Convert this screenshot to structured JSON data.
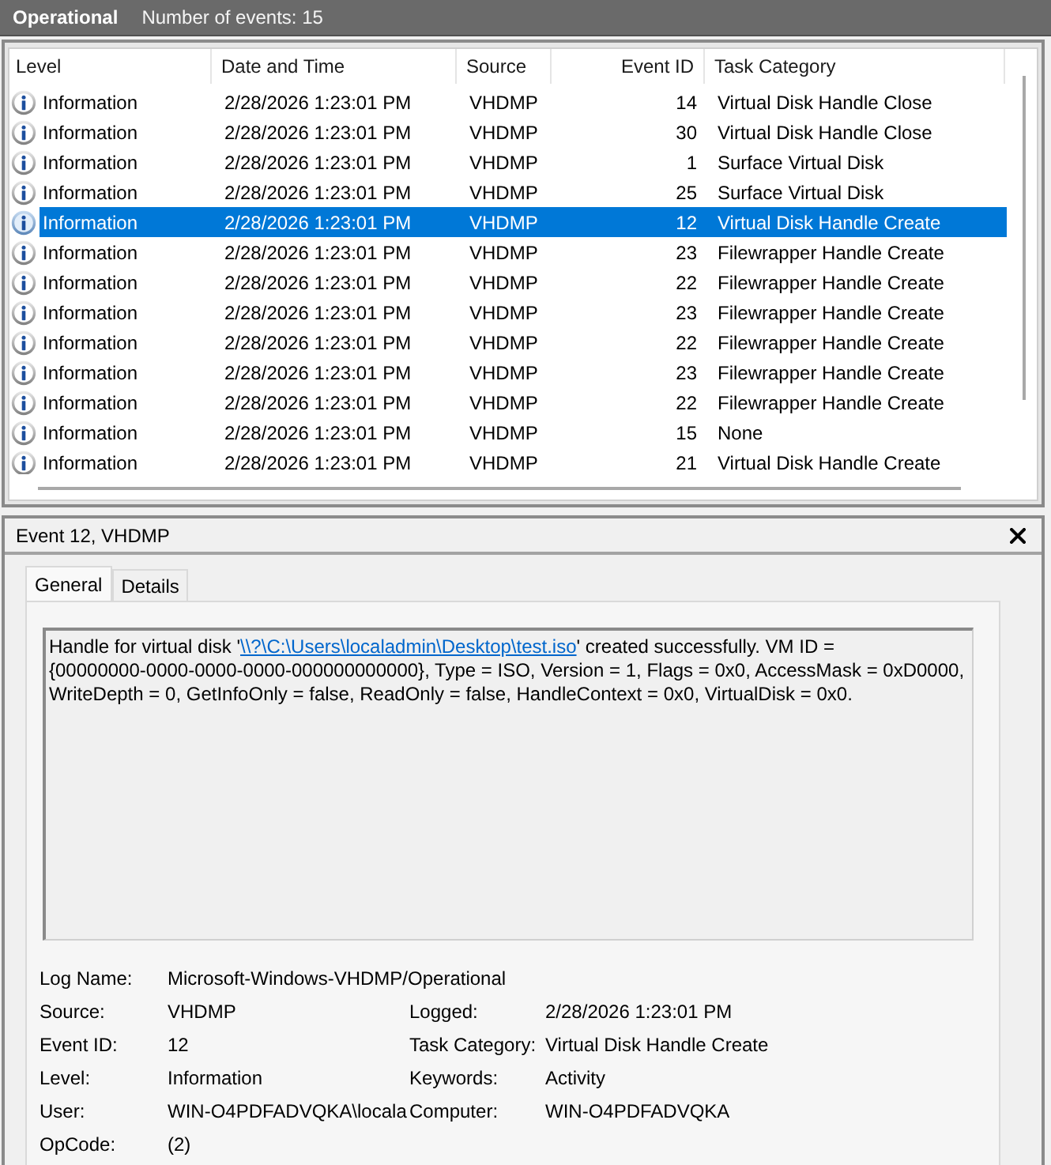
{
  "header": {
    "title": "Operational",
    "event_count": "Number of events: 15"
  },
  "event_list": {
    "columns": [
      "Level",
      "Date and Time",
      "Source",
      "Event ID",
      "Task Category"
    ],
    "rows": [
      {
        "level": "Information",
        "date_time": "2/28/2026 1:23:01 PM",
        "source": "VHDMP",
        "event_id": "14",
        "task_category": "Virtual Disk Handle Close",
        "selected": false
      },
      {
        "level": "Information",
        "date_time": "2/28/2026 1:23:01 PM",
        "source": "VHDMP",
        "event_id": "30",
        "task_category": "Virtual Disk Handle Close",
        "selected": false
      },
      {
        "level": "Information",
        "date_time": "2/28/2026 1:23:01 PM",
        "source": "VHDMP",
        "event_id": "1",
        "task_category": "Surface Virtual Disk",
        "selected": false
      },
      {
        "level": "Information",
        "date_time": "2/28/2026 1:23:01 PM",
        "source": "VHDMP",
        "event_id": "25",
        "task_category": "Surface Virtual Disk",
        "selected": false
      },
      {
        "level": "Information",
        "date_time": "2/28/2026 1:23:01 PM",
        "source": "VHDMP",
        "event_id": "12",
        "task_category": "Virtual Disk Handle Create",
        "selected": true
      },
      {
        "level": "Information",
        "date_time": "2/28/2026 1:23:01 PM",
        "source": "VHDMP",
        "event_id": "23",
        "task_category": "Filewrapper Handle Create",
        "selected": false
      },
      {
        "level": "Information",
        "date_time": "2/28/2026 1:23:01 PM",
        "source": "VHDMP",
        "event_id": "22",
        "task_category": "Filewrapper Handle Create",
        "selected": false
      },
      {
        "level": "Information",
        "date_time": "2/28/2026 1:23:01 PM",
        "source": "VHDMP",
        "event_id": "23",
        "task_category": "Filewrapper Handle Create",
        "selected": false
      },
      {
        "level": "Information",
        "date_time": "2/28/2026 1:23:01 PM",
        "source": "VHDMP",
        "event_id": "22",
        "task_category": "Filewrapper Handle Create",
        "selected": false
      },
      {
        "level": "Information",
        "date_time": "2/28/2026 1:23:01 PM",
        "source": "VHDMP",
        "event_id": "23",
        "task_category": "Filewrapper Handle Create",
        "selected": false
      },
      {
        "level": "Information",
        "date_time": "2/28/2026 1:23:01 PM",
        "source": "VHDMP",
        "event_id": "22",
        "task_category": "Filewrapper Handle Create",
        "selected": false
      },
      {
        "level": "Information",
        "date_time": "2/28/2026 1:23:01 PM",
        "source": "VHDMP",
        "event_id": "15",
        "task_category": "None",
        "selected": false
      },
      {
        "level": "Information",
        "date_time": "2/28/2026 1:23:01 PM",
        "source": "VHDMP",
        "event_id": "21",
        "task_category": "Virtual Disk Handle Create",
        "selected": false
      }
    ]
  },
  "event_detail": {
    "title": "Event 12, VHDMP",
    "tabs": [
      {
        "label": "General",
        "selected": true
      },
      {
        "label": "Details",
        "selected": false
      }
    ],
    "description": {
      "before": "Handle for virtual disk '",
      "link": "\\\\?\\C:\\Users\\localadmin\\Desktop\\test.iso",
      "after": "' created successfully. VM ID = {00000000-0000-0000-0000-000000000000}, Type = ISO, Version = 1, Flags = 0x0, AccessMask = 0xD0000, WriteDepth = 0, GetInfoOnly = false, ReadOnly = false, HandleContext = 0x0, VirtualDisk = 0x0."
    },
    "properties": [
      {
        "fields": [
          {
            "label": "Log Name:",
            "value": "Microsoft-Windows-VHDMP/Operational"
          }
        ]
      },
      {
        "fields": [
          {
            "label": "Source:",
            "value": "VHDMP"
          },
          {
            "label": "Logged:",
            "value": "2/28/2026 1:23:01 PM"
          }
        ]
      },
      {
        "fields": [
          {
            "label": "Event ID:",
            "value": "12"
          },
          {
            "label": "Task Category:",
            "value": "Virtual Disk Handle Create"
          }
        ]
      },
      {
        "fields": [
          {
            "label": "Level:",
            "value": "Information"
          },
          {
            "label": "Keywords:",
            "value": "Activity"
          }
        ]
      },
      {
        "fields": [
          {
            "label": "User:",
            "value": "WIN-O4PDFADVQKA\\locala"
          },
          {
            "label": "Computer:",
            "value": "WIN-O4PDFADVQKA"
          }
        ]
      },
      {
        "fields": [
          {
            "label": "OpCode:",
            "value": "(2)"
          }
        ]
      }
    ]
  }
}
